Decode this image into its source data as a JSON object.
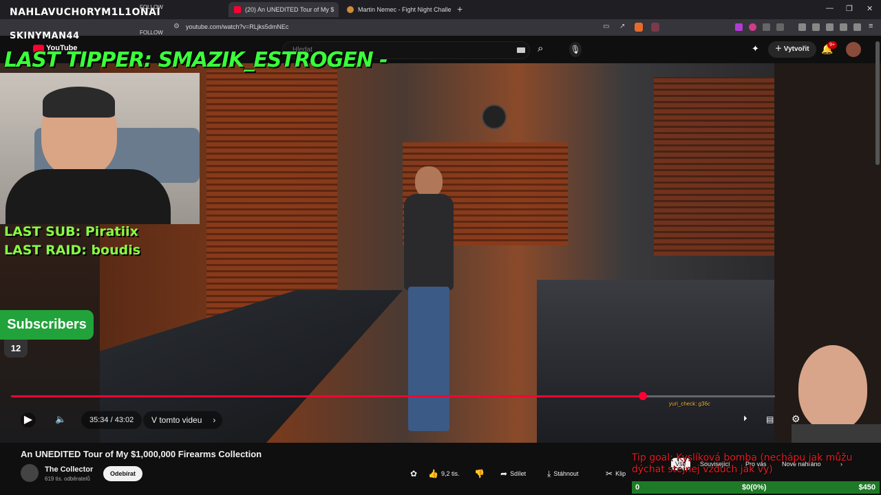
{
  "browser": {
    "tabs": [
      {
        "title": "(20) An UNEDITED Tour of My $",
        "active": true,
        "favicon_color": "#ff0033"
      },
      {
        "title": "Martin Nemec - Fight Night Challenge",
        "active": false,
        "favicon_color": "#d08a3a"
      }
    ],
    "url": "youtube.com/watch?v=RLjks5dmNEc"
  },
  "youtube": {
    "logo": "YouTube",
    "search_placeholder": "Hledat",
    "create_label": "Vytvořit",
    "notifications_badge": "9+"
  },
  "overlay": {
    "follower_1": "NAHLAVUCH0RYM1L1ONAI",
    "follower_2": "SKINYMAN44",
    "follow_label": "FOLLOW",
    "last_tipper": "LAST TIPPER: SMAZIK_ESTROGEN -",
    "last_sub": "LAST SUB: Piratiix",
    "last_raid": "LAST RAID: boudis",
    "subscribers_label": "Subscribers",
    "subscribers_count": "12",
    "chat_line": "yuri_check: g36c",
    "tip_goal": "Tip goal: Kyslíková bomba (nechápu jak můžu dýchat stejnej vzduch jak vy)",
    "goal_start": "0",
    "goal_progress": "$0(0%)",
    "goal_target": "$450",
    "goal_fraction": 0.0
  },
  "player": {
    "time": "35:34 / 43:02",
    "chapter": "V tomto videu",
    "progress_fraction": 0.827
  },
  "video": {
    "title": "An UNEDITED Tour of My $1,000,000 Firearms Collection",
    "channel": "The Collector",
    "channel_subs": "619 tis. odběratelů",
    "subscribe": "Odebírat",
    "likes": "9,2 tis.",
    "share": "Sdílet",
    "download": "Stáhnout",
    "clip": "Klip"
  },
  "chips": [
    "Vše",
    "Související",
    "Pro vás",
    "Nově nahráno"
  ]
}
